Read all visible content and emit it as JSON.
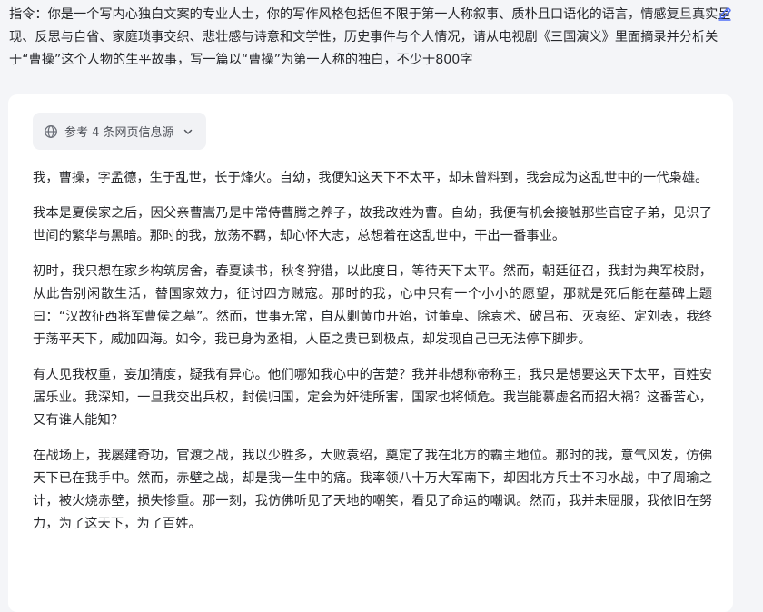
{
  "prompt": {
    "text": "指令：你是一个写内心独白文案的专业人士，你的写作风格包括但不限于第一人称叙事、质朴且口语化的语言，情感复旦真实呈现、反思与自省、家庭琐事交织、悲壮感与诗意和文学性，历史事件与个人情况，请从电视剧《三国演义》里面摘录并分析关于“曹操”这个人物的生平故事，写一篇以“曹操”为第一人称的独白，不少于800字",
    "edit_icon": "pencil-edit-icon"
  },
  "sources": {
    "label": "参考 4 条网页信息源",
    "icon": "globe-icon",
    "toggle_icon": "chevron-down-icon"
  },
  "answer": {
    "paragraphs": [
      "我，曹操，字孟德，生于乱世，长于烽火。自幼，我便知这天下不太平，却未曾料到，我会成为这乱世中的一代枭雄。",
      "我本是夏侯家之后，因父亲曹嵩乃是中常侍曹腾之养子，故我改姓为曹。自幼，我便有机会接触那些官宦子弟，见识了世间的繁华与黑暗。那时的我，放荡不羁，却心怀大志，总想着在这乱世中，干出一番事业。",
      "初时，我只想在家乡构筑房舍，春夏读书，秋冬狩猎，以此度日，等待天下太平。然而，朝廷征召，我封为典军校尉，从此告别闲散生活，替国家效力，征讨四方贼寇。那时的我，心中只有一个小小的愿望，那就是死后能在墓碑上题曰：“汉故征西将军曹侯之墓”。然而，世事无常，自从剿黄巾开始，讨董卓、除袁术、破吕布、灭袁绍、定刘表，我终于荡平天下，威加四海。如今，我已身为丞相，人臣之贵已到极点，却发现自己已无法停下脚步。",
      "有人见我权重，妄加猜度，疑我有异心。他们哪知我心中的苦楚？我并非想称帝称王，我只是想要这天下太平，百姓安居乐业。我深知，一旦我交出兵权，封侯归国，定会为奸徒所害，国家也将倾危。我岂能慕虚名而招大祸？这番苦心，又有谁人能知？",
      "在战场上，我屡建奇功，官渡之战，我以少胜多，大败袁绍，奠定了我在北方的霸主地位。那时的我，意气风发，仿佛天下已在我手中。然而，赤壁之战，却是我一生中的痛。我率领八十万大军南下，却因北方兵士不习水战，中了周瑜之计，被火烧赤壁，损失惨重。那一刻，我仿佛听见了天地的嘲笑，看见了命运的嘲讽。然而，我并未屈服，我依旧在努力，为了这天下，为了百姓。"
    ]
  }
}
